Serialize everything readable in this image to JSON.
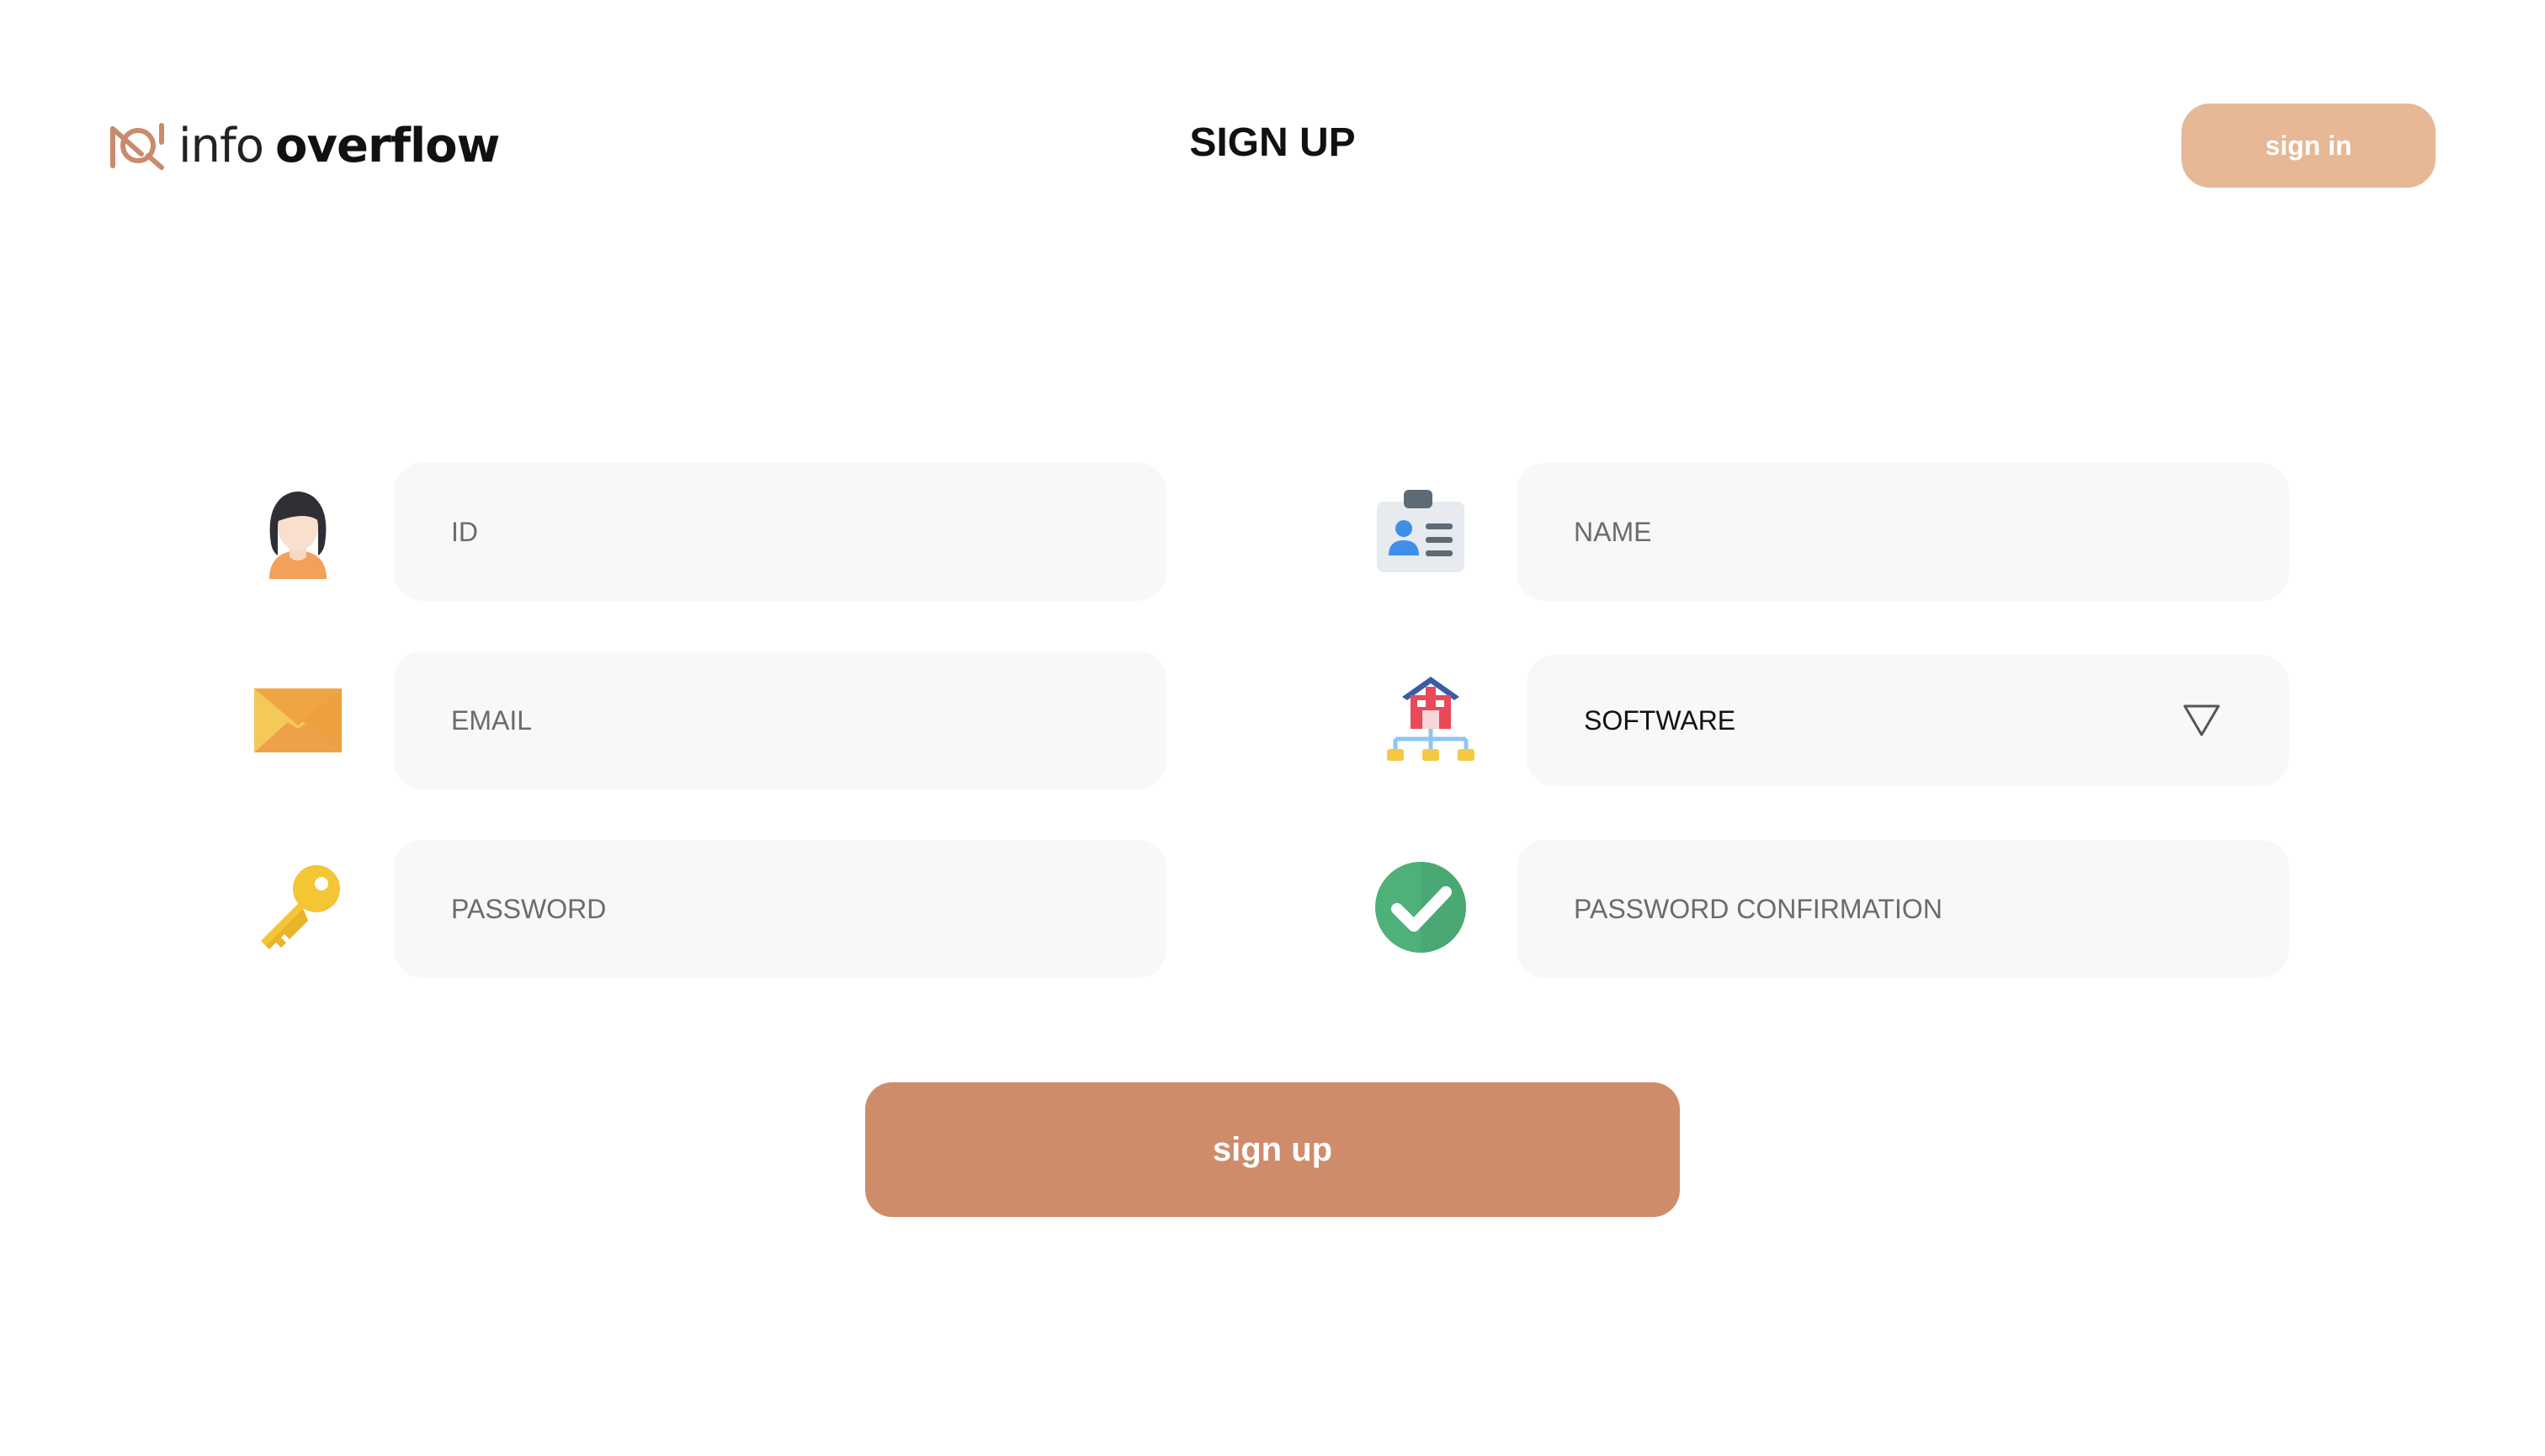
{
  "header": {
    "logo_light": "info",
    "logo_bold": "overflow",
    "title": "SIGN UP",
    "signin_label": "sign in"
  },
  "form": {
    "id_placeholder": "ID",
    "name_placeholder": "NAME",
    "email_placeholder": "EMAIL",
    "department_selected": "SOFTWARE",
    "password_placeholder": "PASSWORD",
    "password_confirm_placeholder": "PASSWORD CONFIRMATION",
    "submit_label": "sign up"
  },
  "icons": {
    "id": "user-avatar-icon",
    "name": "id-card-icon",
    "email": "envelope-icon",
    "department": "organization-icon",
    "password": "key-icon",
    "password_confirm": "check-circle-icon",
    "select_arrow": "triangle-down-icon"
  },
  "colors": {
    "brand": "#cf8c6a",
    "signin_button": "#e6b895",
    "field_background": "#f8f8f8"
  }
}
